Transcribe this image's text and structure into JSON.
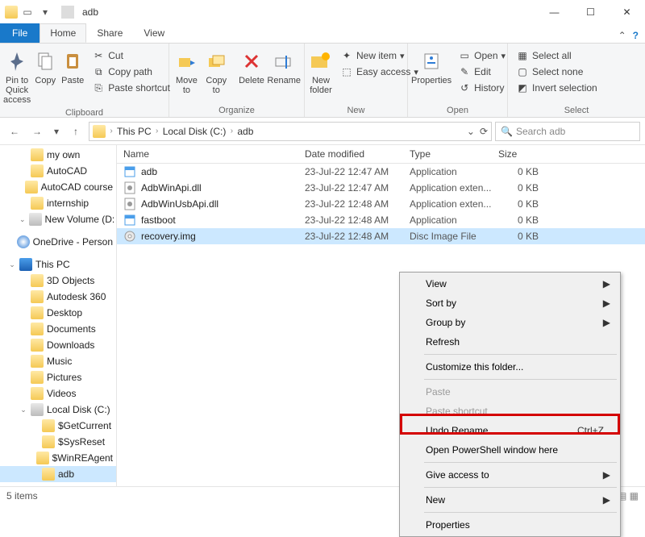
{
  "title": "adb",
  "tabs": {
    "file": "File",
    "home": "Home",
    "share": "Share",
    "view": "View"
  },
  "ribbon": {
    "clipboard": {
      "label": "Clipboard",
      "pin": "Pin to Quick access",
      "copy": "Copy",
      "paste": "Paste",
      "cut": "Cut",
      "copypath": "Copy path",
      "pasteshort": "Paste shortcut"
    },
    "organize": {
      "label": "Organize",
      "moveto": "Move to",
      "copyto": "Copy to",
      "delete": "Delete",
      "rename": "Rename"
    },
    "new": {
      "label": "New",
      "newfolder": "New folder",
      "newitem": "New item",
      "easyaccess": "Easy access"
    },
    "open": {
      "label": "Open",
      "properties": "Properties",
      "open": "Open",
      "edit": "Edit",
      "history": "History"
    },
    "select": {
      "label": "Select",
      "all": "Select all",
      "none": "Select none",
      "invert": "Invert selection"
    }
  },
  "breadcrumbs": [
    "This PC",
    "Local Disk (C:)",
    "adb"
  ],
  "search_placeholder": "Search adb",
  "sidebar": {
    "items": [
      {
        "label": "my own",
        "kind": "folder",
        "indent": 1
      },
      {
        "label": "AutoCAD",
        "kind": "folder",
        "indent": 1
      },
      {
        "label": "AutoCAD course",
        "kind": "folder",
        "indent": 1
      },
      {
        "label": "internship",
        "kind": "folder",
        "indent": 1
      },
      {
        "label": "New Volume (D:",
        "kind": "disk",
        "indent": 1
      },
      {
        "label": "OneDrive - Person",
        "kind": "cloud",
        "indent": 0,
        "gap": true
      },
      {
        "label": "This PC",
        "kind": "pc",
        "indent": 0,
        "gap": true
      },
      {
        "label": "3D Objects",
        "kind": "folder",
        "indent": 1
      },
      {
        "label": "Autodesk 360",
        "kind": "folder",
        "indent": 1
      },
      {
        "label": "Desktop",
        "kind": "folder",
        "indent": 1
      },
      {
        "label": "Documents",
        "kind": "folder",
        "indent": 1
      },
      {
        "label": "Downloads",
        "kind": "folder",
        "indent": 1
      },
      {
        "label": "Music",
        "kind": "folder",
        "indent": 1
      },
      {
        "label": "Pictures",
        "kind": "folder",
        "indent": 1
      },
      {
        "label": "Videos",
        "kind": "folder",
        "indent": 1
      },
      {
        "label": "Local Disk (C:)",
        "kind": "disk",
        "indent": 1
      },
      {
        "label": "$GetCurrent",
        "kind": "folder",
        "indent": 2
      },
      {
        "label": "$SysReset",
        "kind": "folder",
        "indent": 2
      },
      {
        "label": "$WinREAgent",
        "kind": "folder",
        "indent": 2
      },
      {
        "label": "adb",
        "kind": "folder",
        "indent": 2,
        "selected": true
      }
    ]
  },
  "columns": {
    "name": "Name",
    "date": "Date modified",
    "type": "Type",
    "size": "Size"
  },
  "files": [
    {
      "name": "adb",
      "date": "23-Jul-22 12:47 AM",
      "type": "Application",
      "size": "0 KB",
      "icon": "app"
    },
    {
      "name": "AdbWinApi.dll",
      "date": "23-Jul-22 12:47 AM",
      "type": "Application exten...",
      "size": "0 KB",
      "icon": "dll"
    },
    {
      "name": "AdbWinUsbApi.dll",
      "date": "23-Jul-22 12:48 AM",
      "type": "Application exten...",
      "size": "0 KB",
      "icon": "dll"
    },
    {
      "name": "fastboot",
      "date": "23-Jul-22 12:48 AM",
      "type": "Application",
      "size": "0 KB",
      "icon": "app"
    },
    {
      "name": "recovery.img",
      "date": "23-Jul-22 12:48 AM",
      "type": "Disc Image File",
      "size": "0 KB",
      "icon": "disc",
      "selected": true
    }
  ],
  "status": "5 items",
  "context": {
    "view": "View",
    "sort": "Sort by",
    "group": "Group by",
    "refresh": "Refresh",
    "customize": "Customize this folder...",
    "paste": "Paste",
    "pasteshort": "Paste shortcut",
    "undo": "Undo Rename",
    "undo_key": "Ctrl+Z",
    "powershell": "Open PowerShell window here",
    "give": "Give access to",
    "new": "New",
    "properties": "Properties"
  }
}
